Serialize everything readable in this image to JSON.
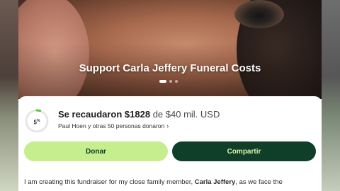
{
  "hero": {
    "title": "Support Carla Jeffery Funeral Costs",
    "slide_count": 3,
    "active_slide": 0
  },
  "progress": {
    "percent_label": "5",
    "percent_suffix": "%",
    "fraction": 0.05,
    "raised_text": "Se recaudaron $1828",
    "goal_text": "de $40 mil. USD",
    "donors_text": "Paul Hoen y otras 50 personas donaron",
    "donors_chevron": "›"
  },
  "actions": {
    "donate_label": "Donar",
    "share_label": "Compartir"
  },
  "story": {
    "intro": "I am creating this fundraiser for my close family member, ",
    "name": "Carla Jeffery",
    "rest": ", as we face the"
  },
  "colors": {
    "donate_bg": "#c6ee8f",
    "share_bg": "#103f29",
    "progress_accent": "#5cc24a"
  }
}
